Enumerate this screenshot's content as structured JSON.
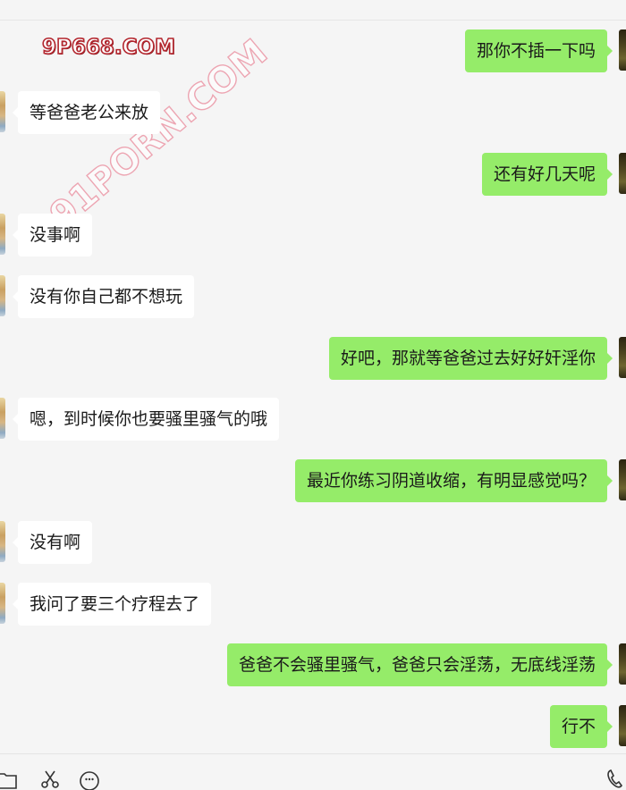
{
  "watermark": {
    "site": "9P668.COM",
    "diagonal": "91PORN.COM"
  },
  "messages": [
    {
      "side": "right",
      "text": "那你不插一下吗"
    },
    {
      "side": "left",
      "text": "等爸爸老公来放"
    },
    {
      "side": "right",
      "text": "还有好几天呢"
    },
    {
      "side": "left",
      "text": "没事啊"
    },
    {
      "side": "left",
      "text": "没有你自己都不想玩"
    },
    {
      "side": "right",
      "text": "好吧，那就等爸爸过去好好奸淫你"
    },
    {
      "side": "left",
      "text": "嗯，到时候你也要骚里骚气的哦"
    },
    {
      "side": "right",
      "text": "最近你练习阴道收缩，有明显感觉吗？"
    },
    {
      "side": "left",
      "text": "没有啊"
    },
    {
      "side": "left",
      "text": "我问了要三个疗程去了"
    },
    {
      "side": "right",
      "text": "爸爸不会骚里骚气，爸爸只会淫荡，无底线淫荡"
    },
    {
      "side": "right",
      "text": "行不"
    }
  ],
  "toolbar": {
    "icons": [
      "folder-icon",
      "scissors-icon",
      "emoji-icon",
      "phone-icon"
    ]
  },
  "colors": {
    "background": "#f5f5f5",
    "incoming_bubble": "#ffffff",
    "outgoing_bubble": "#95ec69"
  }
}
